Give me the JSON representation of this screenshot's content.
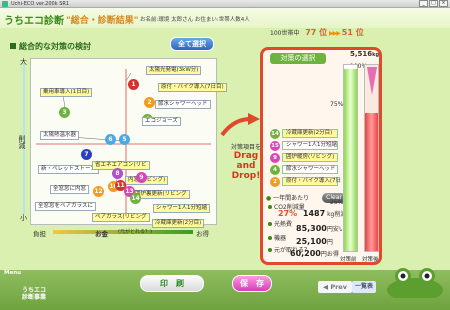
{
  "window": {
    "title": "Uchi-ECO ver.200k SR1"
  },
  "header": {
    "logo": "うちエコ診断",
    "title": "\"総合・診断結果\"",
    "user_info": "お名前:環境 太郎さん お住まい:世帯人数4人"
  },
  "ranking": {
    "prefix": "100世帯中",
    "before": "77 位",
    "after": "51 位"
  },
  "section": {
    "title": "総合的な対策の検討",
    "select_all": "全て選択"
  },
  "axis": {
    "y_top": "大",
    "y_mid": "削減",
    "y_bottom": "小",
    "x_left": "負担",
    "x_mid": "お金",
    "x_mid_sub": "(元がとれる？)",
    "x_right": "お得"
  },
  "measures": [
    {
      "num": "1",
      "color": "#d83030",
      "label": "太陽光発電(3kW分)"
    },
    {
      "num": "2",
      "color": "#f29b1c",
      "label": "原付・バイク導入(7日目)"
    },
    {
      "num": "3",
      "color": "#6fb33f",
      "label": "乗用車導入(1日目)"
    },
    {
      "num": "4",
      "color": "#6fb33f",
      "label": "節水シャワーヘッド"
    },
    {
      "num": "5",
      "color": "#4aa8e6",
      "label": "エコジョーズ"
    },
    {
      "num": "6",
      "color": "#4aa8e6",
      "label": "太陽熱温水器"
    },
    {
      "num": "7",
      "color": "#2a3fbf",
      "label": "新・ペレットストーブ"
    },
    {
      "num": "8",
      "color": "#b04fc8",
      "label": "省エネエアコン(リビ"
    },
    {
      "num": "9",
      "color": "#d944b6",
      "label": "内窓(リビング)"
    },
    {
      "num": "10",
      "color": "#f29b1c",
      "label": "全窓窓に内窓"
    },
    {
      "num": "11",
      "color": "#d83030",
      "label": "高断熱ペアガラス"
    },
    {
      "num": "12",
      "color": "#f29b1c",
      "label": "全窓窓をペアガラスに"
    },
    {
      "num": "13",
      "color": "#d944b6",
      "label": "ペアガラス(リビング"
    },
    {
      "num": "14",
      "color": "#6fb33f",
      "label": "冷蔵庫更新(2分目)"
    },
    {
      "num": "15",
      "color": "#d944b6",
      "label": "シャワー1人1分短縮"
    },
    {
      "num": "16",
      "color": "#f29b1c",
      "label": "高効率照明(リビング"
    }
  ],
  "extra_labels": {
    "a": "囲炉裏更新(リビング",
    "b": "シャワー1人1分短縮",
    "c": "冷蔵庫更新(2分目)"
  },
  "drag_hint": {
    "line1": "対策項目を",
    "line2": "Drag",
    "line3": "and",
    "line4": "Drop!"
  },
  "selection_panel": {
    "title": "対策の選択",
    "items": [
      {
        "num": "14",
        "color": "#6fb33f",
        "label": "冷蔵庫更新(2分目)"
      },
      {
        "num": "15",
        "color": "#d944b6",
        "label": "シャワー1人1分短縮"
      },
      {
        "num": "9",
        "color": "#d944b6",
        "label": "囲炉暖房(リビング)"
      },
      {
        "num": "4",
        "color": "#6fb33f",
        "label": "節水シャワーヘッド"
      },
      {
        "num": "2",
        "color": "#f29b1c",
        "label": "原付・バイク導入(7日"
      }
    ],
    "clear_label": "Clear"
  },
  "results": {
    "header": "一年間あたり",
    "co2_label": "CO2削減量",
    "co2_pct": "27",
    "co2_kg": "1487",
    "co2_unit": "kg削減",
    "cost_label": "光熱費",
    "cost_value": "85,300",
    "cost_unit": "円安い",
    "invest_label": "機器",
    "invest_value": "25,100",
    "invest_unit": "円",
    "payback_label": "元が取れる？",
    "payback_value": "60,200",
    "payback_unit": "円お得"
  },
  "bars": {
    "total_kg": "5,516",
    "total_unit": "kg",
    "pct_top": "100%",
    "pct_75": "75%",
    "pct_25": "25%",
    "label_before": "対策前",
    "label_after": "対策後",
    "before_ratio": 0.98,
    "after_ratio": 0.74
  },
  "footer": {
    "menu": "Menu",
    "brand_line1": "うちエコ",
    "brand_line2": "診断事業",
    "print": "印　刷",
    "save": "保　存",
    "prev": "Prev",
    "list": "一覧表"
  }
}
